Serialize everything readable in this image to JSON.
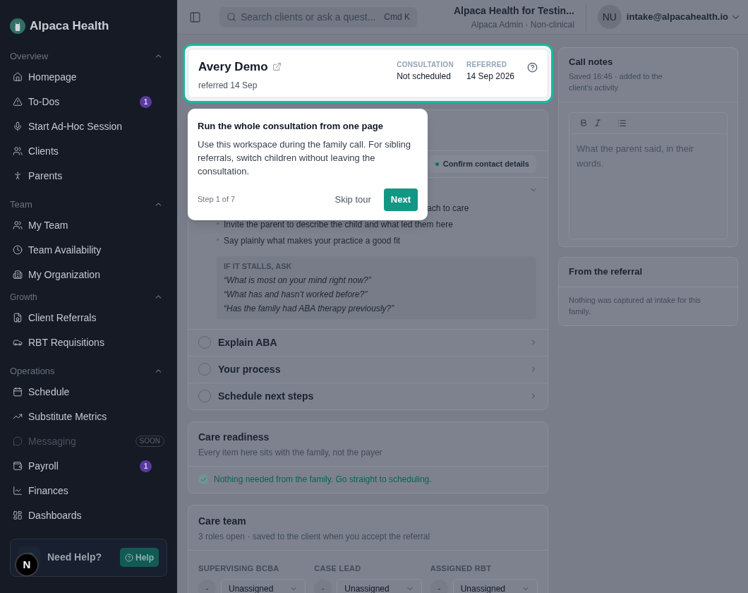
{
  "sidebar": {
    "brand": "Alpaca Health",
    "sections": [
      {
        "title": "Overview",
        "expanded": true,
        "items": [
          {
            "label": "Homepage",
            "kind": "home",
            "disabled": false
          },
          {
            "label": "To-Dos",
            "kind": "alert",
            "disabled": false,
            "badge": "1"
          },
          {
            "label": "Start Ad-Hoc Session",
            "kind": "mic",
            "disabled": false
          },
          {
            "label": "Clients",
            "kind": "users",
            "disabled": false
          },
          {
            "label": "Parents",
            "kind": "person",
            "disabled": false
          }
        ]
      },
      {
        "title": "Team",
        "expanded": true,
        "items": [
          {
            "label": "My Team",
            "kind": "users",
            "disabled": false
          },
          {
            "label": "Team Availability",
            "kind": "clock",
            "disabled": false
          },
          {
            "label": "My Organization",
            "kind": "building",
            "disabled": false
          }
        ]
      },
      {
        "title": "Growth",
        "expanded": true,
        "items": [
          {
            "label": "Client Referrals",
            "kind": "referral",
            "disabled": false
          },
          {
            "label": "RBT Requisitions",
            "kind": "car",
            "disabled": false
          }
        ]
      },
      {
        "title": "Operations",
        "expanded": true,
        "items": [
          {
            "label": "Schedule",
            "kind": "calendar",
            "disabled": false
          },
          {
            "label": "Substitute Metrics",
            "kind": "trend",
            "disabled": false
          },
          {
            "label": "Messaging",
            "kind": "message",
            "disabled": true,
            "tag": "SOON"
          },
          {
            "label": "Payroll",
            "kind": "wallet",
            "disabled": false,
            "badge": "1"
          },
          {
            "label": "Finances",
            "kind": "chart",
            "disabled": false
          },
          {
            "label": "Dashboards",
            "kind": "dashboard",
            "disabled": false
          }
        ]
      }
    ],
    "help": {
      "title": "Need Help?",
      "button": "Help"
    },
    "dev_badge": "N"
  },
  "topbar": {
    "search": {
      "placeholder": "Search clients or ask a quest...",
      "shortcut": "Cmd K"
    },
    "org": "Alpaca Health for Testin...",
    "role": "Alpaca Admin · Non-clinical",
    "avatar": "NU",
    "email": "intake@alpacahealth.io"
  },
  "client_card": {
    "name": "Avery Demo",
    "subtitle": "referred 14 Sep",
    "fields": [
      {
        "label": "CONSULTATION",
        "value": "Not scheduled"
      },
      {
        "label": "REFERRED",
        "value": "14 Sep 2026"
      }
    ]
  },
  "tour": {
    "title": "Run the whole consultation from one page",
    "body": "Use this workspace during the family call. For sibling referrals, switch children without leaving the consultation.",
    "step": "Step 1 of 7",
    "skip": "Skip tour",
    "next": "Next"
  },
  "checklist": {
    "chip": "Confirm contact details",
    "steps": [
      {
        "expanded": true,
        "bullets": [
          {
            "text": "ach to care",
            "kind": "partial"
          },
          {
            "text": "Invite the parent to describe the child and what led them here",
            "kind": "full"
          },
          {
            "text": "Say plainly what makes your practice a good fit",
            "kind": "full"
          }
        ],
        "prompts": {
          "title": "IF IT STALLS, ASK",
          "lines": [
            "“What is most on your mind right now?”",
            "“What has and hasn’t worked before?”",
            "“Has the family had ABA therapy previously?”"
          ]
        }
      },
      {
        "title": "Explain ABA",
        "expanded": false
      },
      {
        "title": "Your process",
        "expanded": false
      },
      {
        "title": "Schedule next steps",
        "expanded": false
      }
    ]
  },
  "care_readiness": {
    "title": "Care readiness",
    "subtitle": "Every item here sits with the family, not the payer",
    "status": "Nothing needed from the family. Go straight to scheduling."
  },
  "care_team": {
    "title": "Care team",
    "subtitle": "3 roles open · saved to the client when you accept the referral",
    "roles": [
      {
        "label": "SUPERVISING BCBA",
        "avatar": "-",
        "value": "Unassigned"
      },
      {
        "label": "CASE LEAD",
        "avatar": "-",
        "value": "Unassigned"
      },
      {
        "label": "ASSIGNED RBT",
        "avatar": "-",
        "value": "Unassigned"
      }
    ]
  },
  "call_notes": {
    "title": "Call notes",
    "subtitle": "Saved 16:45 · added to the client's activity",
    "placeholder": "What the parent said, in their words."
  },
  "referral": {
    "title": "From the referral",
    "body": "Nothing was captured at intake for this family."
  }
}
